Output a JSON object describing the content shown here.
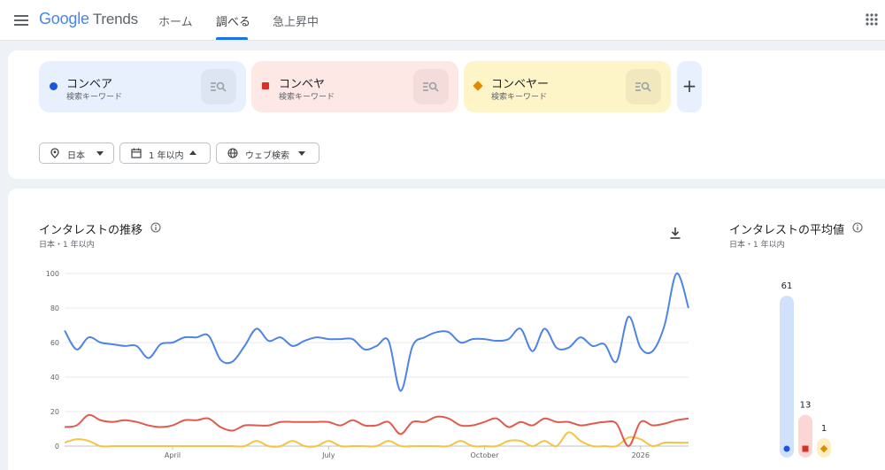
{
  "header": {
    "logo_google": "Google",
    "logo_trends": "Trends",
    "nav": [
      {
        "label": "ホーム",
        "active": false
      },
      {
        "label": "調べる",
        "active": true
      },
      {
        "label": "急上昇中",
        "active": false
      }
    ]
  },
  "terms": [
    {
      "name": "コンベア",
      "sub": "検索キーワード",
      "color": "#1a56db",
      "bg": "#e8f0fd",
      "btn": "#dde5f2",
      "marker": "circle"
    },
    {
      "name": "コンベヤ",
      "sub": "検索キーワード",
      "color": "#d93025",
      "bg": "#fde8e6",
      "btn": "#f3dcda",
      "marker": "square"
    },
    {
      "name": "コンベヤー",
      "sub": "検索キーワード",
      "color": "#e08a00",
      "bg": "#fdf4c8",
      "btn": "#f1e8bd",
      "marker": "diamond"
    }
  ],
  "add_term": "+",
  "filters": {
    "region": "日本",
    "period": "1 年以内",
    "search_type": "ウェブ検索"
  },
  "interest_over_time": {
    "title": "インタレストの推移",
    "subtitle": "日本・1 年以内"
  },
  "average_interest": {
    "title": "インタレストの平均値",
    "subtitle": "日本・1 年以内"
  },
  "chart_data": [
    {
      "type": "line",
      "ylim": [
        0,
        100
      ],
      "yticks": [
        0,
        20,
        40,
        60,
        80,
        100
      ],
      "xtick_labels": [
        {
          "label": "April",
          "index": 9
        },
        {
          "label": "July",
          "index": 22
        },
        {
          "label": "October",
          "index": 35
        },
        {
          "label": "2026",
          "index": 48
        }
      ],
      "grid": true,
      "series": [
        {
          "name": "コンベア",
          "color": "#4e84e6",
          "values": [
            67,
            56,
            63,
            60,
            59,
            58,
            58,
            51,
            59,
            60,
            63,
            63,
            64,
            50,
            49,
            58,
            68,
            61,
            63,
            58,
            61,
            63,
            62,
            62,
            62,
            56,
            58,
            61,
            32,
            58,
            63,
            66,
            66,
            60,
            62,
            62,
            61,
            62,
            68,
            55,
            68,
            57,
            57,
            63,
            58,
            59,
            49,
            75,
            57,
            55,
            70,
            100,
            80
          ]
        },
        {
          "name": "コンベヤ",
          "color": "#e05a4e",
          "values": [
            11,
            12,
            18,
            15,
            14,
            15,
            14,
            12,
            11,
            12,
            15,
            15,
            16,
            11,
            9,
            12,
            12,
            12,
            14,
            14,
            14,
            14,
            14,
            12,
            15,
            12,
            12,
            14,
            7,
            14,
            14,
            17,
            16,
            12,
            12,
            14,
            16,
            11,
            14,
            12,
            16,
            14,
            14,
            12,
            13,
            14,
            13,
            0,
            14,
            12,
            13,
            15,
            16
          ]
        },
        {
          "name": "コンベヤー",
          "color": "#f6c344",
          "values": [
            2,
            4,
            3,
            0,
            0,
            0,
            0,
            0,
            0,
            0,
            0,
            0,
            0,
            0,
            0,
            0,
            3,
            0,
            0,
            3,
            0,
            0,
            3,
            0,
            0,
            0,
            0,
            3,
            0,
            0,
            0,
            0,
            0,
            3,
            0,
            0,
            0,
            3,
            3,
            0,
            3,
            0,
            8,
            3,
            0,
            0,
            0,
            5,
            4,
            0,
            2,
            2,
            2
          ]
        }
      ]
    },
    {
      "type": "bar",
      "categories": [
        "コンベア",
        "コンベヤ",
        "コンベヤー"
      ],
      "values": [
        61,
        13,
        1
      ],
      "colors": [
        "#d2e1fb",
        "#fad7d3",
        "#fdefc2"
      ],
      "marker_colors": [
        "#1a56db",
        "#d93025",
        "#e08a00"
      ]
    }
  ]
}
